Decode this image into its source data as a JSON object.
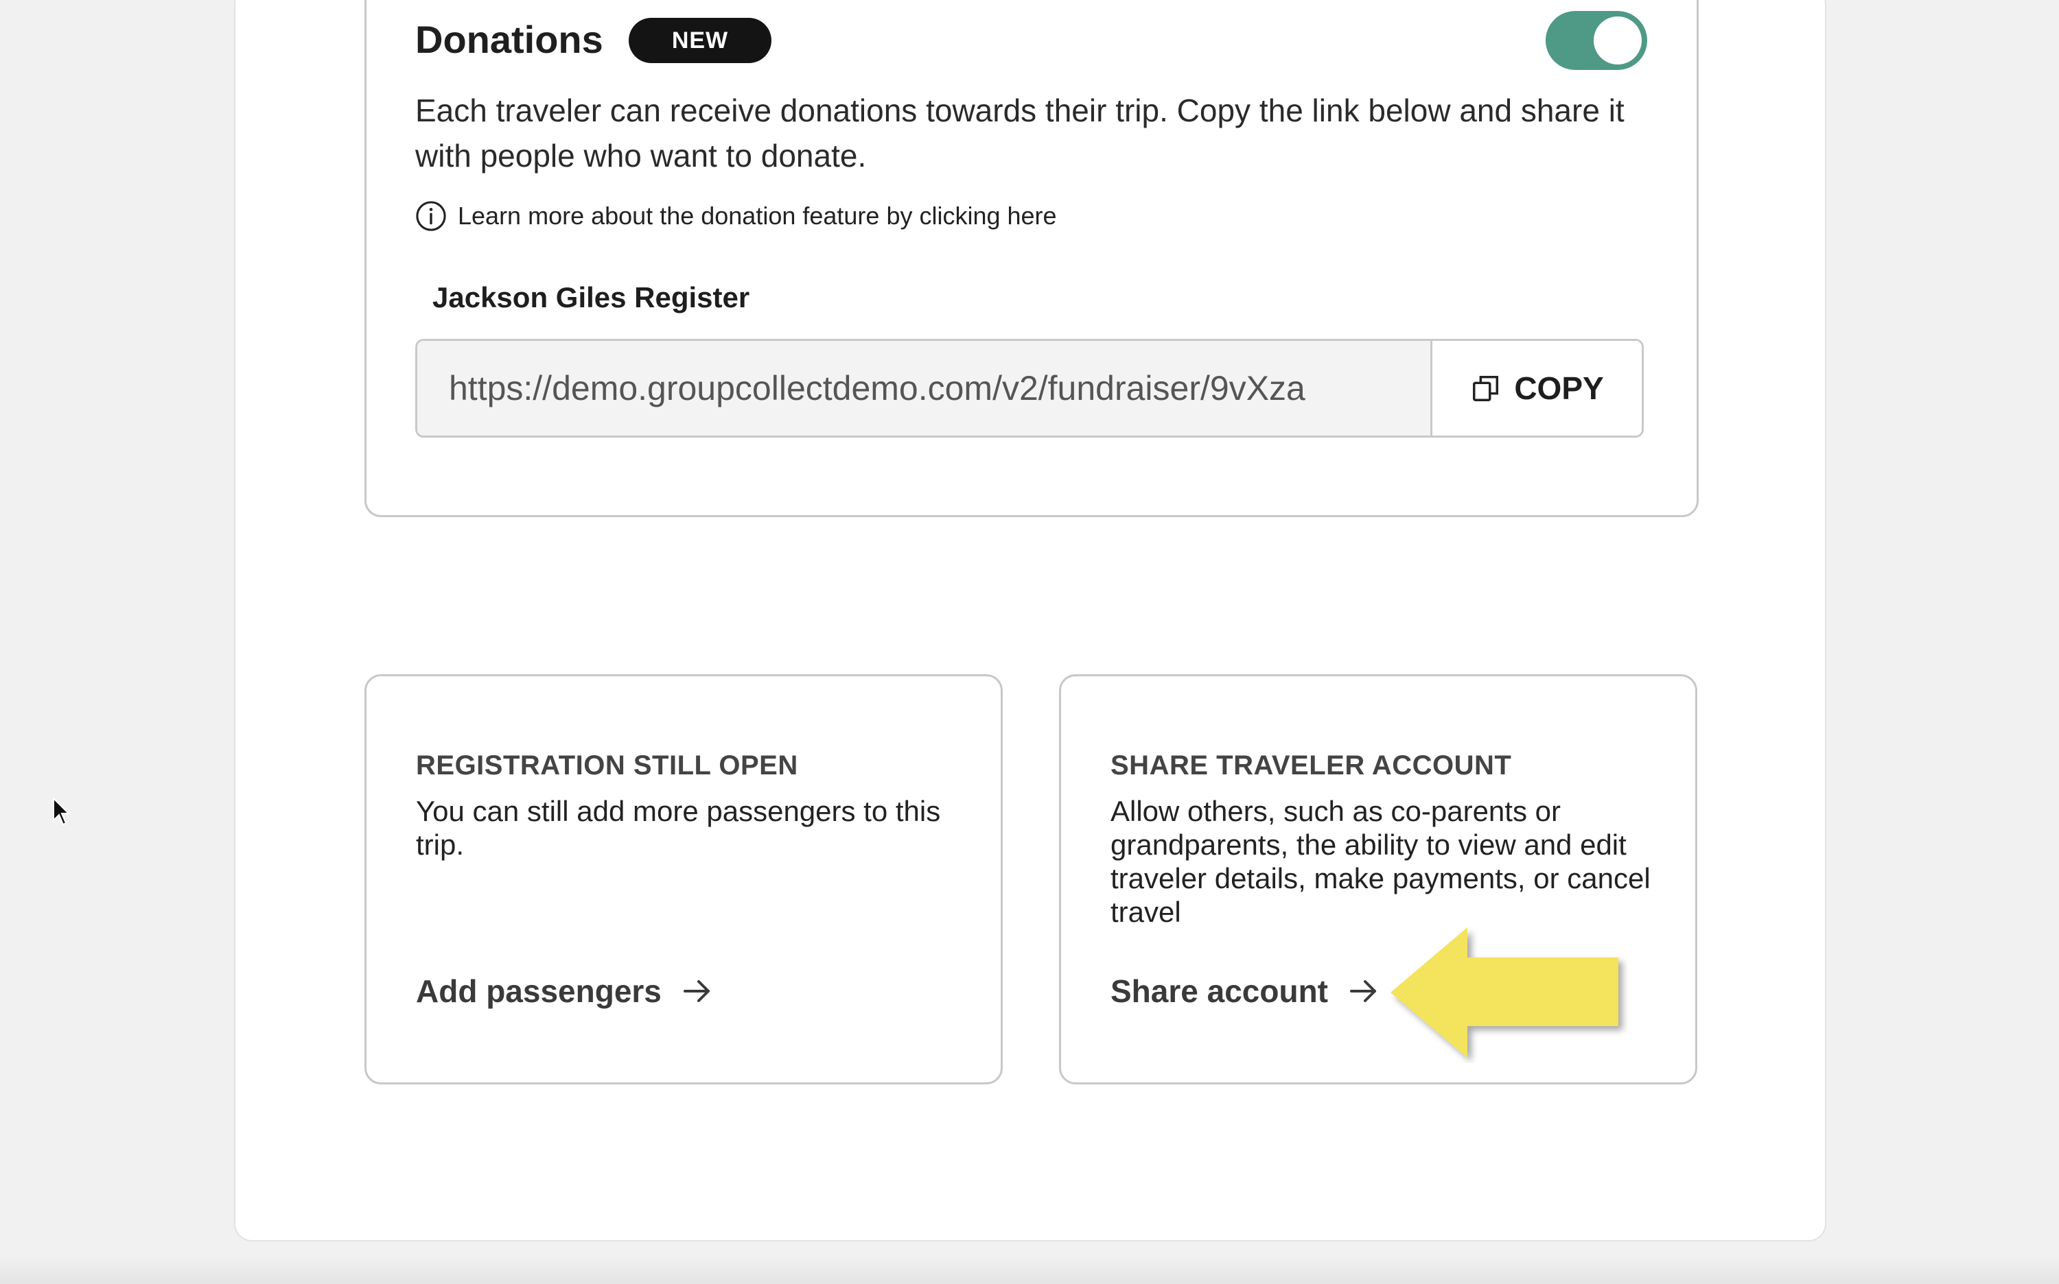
{
  "donations": {
    "title": "Donations",
    "badge": "NEW",
    "toggle_state": "on",
    "description": "Each traveler can receive donations towards their trip. Copy the link below and share it with people who want to donate.",
    "learn_more": "Learn more about the donation feature by clicking here",
    "register_name": "Jackson Giles Register",
    "fundraiser_url": "https://demo.groupcollectdemo.com/v2/fundraiser/9vXza",
    "copy_label": "COPY"
  },
  "registration_card": {
    "heading": "REGISTRATION STILL OPEN",
    "body": "You can still add more passengers to this trip.",
    "link_label": "Add passengers"
  },
  "share_card": {
    "heading": "SHARE TRAVELER ACCOUNT",
    "body": "Allow others, such as co-parents or grandparents, the ability to view and edit traveler details, make payments, or cancel travel",
    "link_label": "Share account"
  },
  "colors": {
    "toggle_on": "#4e9a86",
    "badge_bg": "#141414",
    "callout_arrow": "#f4e35c"
  },
  "icons": {
    "info": "info-circle-icon",
    "copy": "copy-icon",
    "arrow": "arrow-right-icon",
    "cursor": "mouse-cursor-icon"
  }
}
